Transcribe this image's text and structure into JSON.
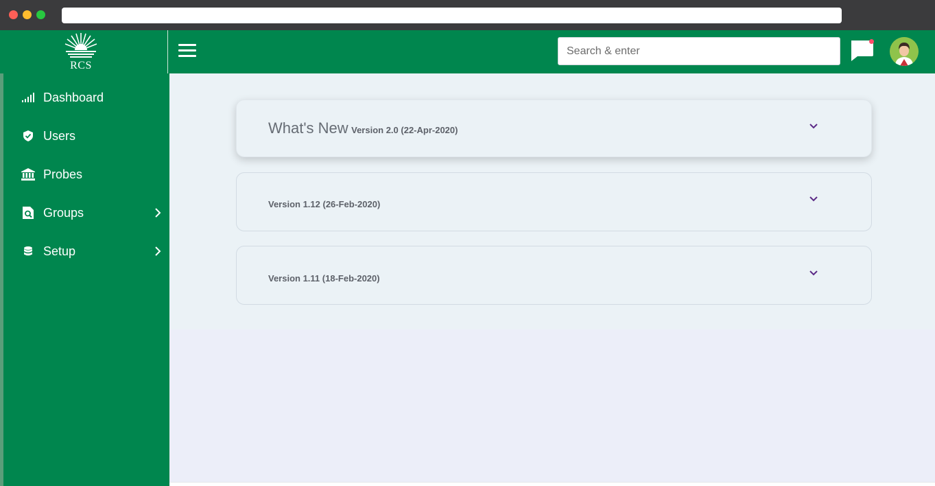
{
  "header": {
    "logo_text": "RCS",
    "search_placeholder": "Search & enter"
  },
  "sidebar": {
    "items": [
      {
        "label": "Dashboard",
        "icon": "signal-bars-icon",
        "has_submenu": false
      },
      {
        "label": "Users",
        "icon": "shield-check-icon",
        "has_submenu": false
      },
      {
        "label": "Probes",
        "icon": "bank-icon",
        "has_submenu": false
      },
      {
        "label": "Groups",
        "icon": "file-search-icon",
        "has_submenu": true
      },
      {
        "label": "Setup",
        "icon": "database-icon",
        "has_submenu": true
      }
    ]
  },
  "main": {
    "panels": [
      {
        "heading": "What's New",
        "version": "Version 2.0 (22-Apr-2020)",
        "active": true
      },
      {
        "heading": "",
        "version": "Version 1.12 (26-Feb-2020)",
        "active": false
      },
      {
        "heading": "",
        "version": "Version 1.11 (18-Feb-2020)",
        "active": false
      }
    ]
  },
  "colors": {
    "brand_green": "#00864e",
    "chevron_purple": "#5b2a86",
    "notification_dot": "#ff4d6a"
  }
}
